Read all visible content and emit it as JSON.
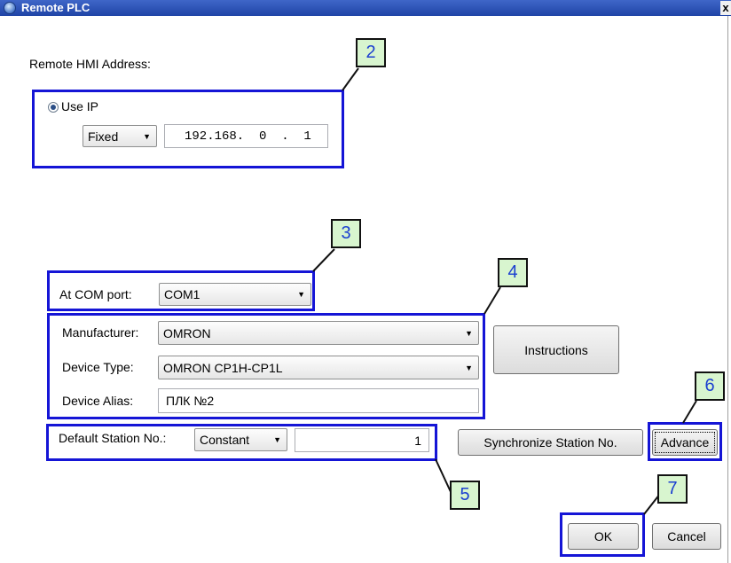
{
  "window": {
    "title": "Remote PLC",
    "close_label": "x"
  },
  "address_section": {
    "label": "Remote HMI Address:",
    "use_ip_label": "Use IP",
    "ip_mode": "Fixed",
    "ip_value": "192.168.  0  .  1"
  },
  "com_port": {
    "label": "At COM port:",
    "value": "COM1"
  },
  "device": {
    "manufacturer_label": "Manufacturer:",
    "manufacturer_value": "OMRON",
    "type_label": "Device Type:",
    "type_value": "OMRON CP1H-CP1L",
    "alias_label": "Device Alias:",
    "alias_value": "ПЛК №2",
    "instructions_label": "Instructions"
  },
  "station": {
    "label": "Default Station No.:",
    "mode": "Constant",
    "value": "1",
    "sync_label": "Synchronize Station No.",
    "advance_label": "Advance"
  },
  "footer": {
    "ok_label": "OK",
    "cancel_label": "Cancel"
  },
  "callouts": {
    "b2": "2",
    "b3": "3",
    "b4": "4",
    "b5": "5",
    "b6": "6",
    "b7": "7"
  },
  "colors": {
    "highlight": "#1515d6",
    "badge_fill": "#d8f5cf",
    "badge_text": "#1b3fd0"
  }
}
